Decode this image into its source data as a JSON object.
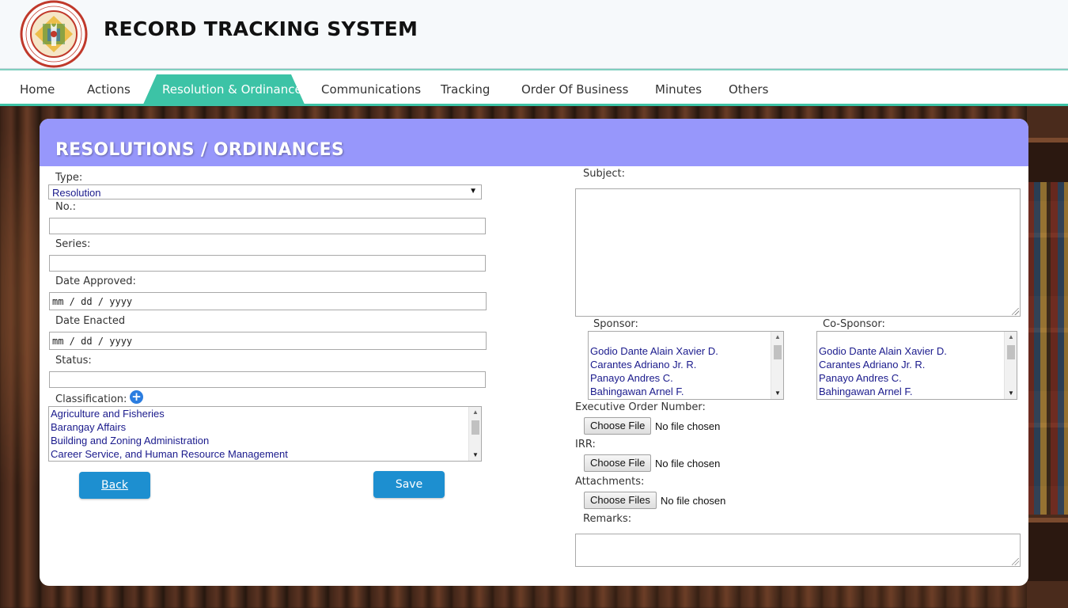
{
  "header": {
    "title": "RECORD TRACKING SYSTEM",
    "logo": {
      "top_text": "MUNICIPALITY OF ITOGON",
      "bottom_text": "PROVINCE OF BENGUET",
      "year": "1923"
    }
  },
  "nav": {
    "items": [
      {
        "label": "Home"
      },
      {
        "label": "Actions"
      },
      {
        "label": "Resolution & Ordinance",
        "active": true
      },
      {
        "label": "Communications"
      },
      {
        "label": "Tracking"
      },
      {
        "label": "Order Of Business"
      },
      {
        "label": "Minutes"
      },
      {
        "label": "Others"
      }
    ],
    "accent_color": "#3cc3a6"
  },
  "card": {
    "title": "RESOLUTIONS / ORDINANCES",
    "header_color": "#9797fb"
  },
  "form": {
    "type_label": "Type:",
    "type_value": "Resolution",
    "no_label": "No.:",
    "no_value": "",
    "series_label": "Series:",
    "series_value": "",
    "date_approved_label": "Date Approved:",
    "date_approved_placeholder": "mm / dd / yyyy",
    "date_enacted_label": "Date Enacted",
    "date_enacted_placeholder": "mm / dd / yyyy",
    "status_label": "Status:",
    "status_value": "",
    "classification_label": "Classification:",
    "classification_options": [
      "Agriculture and Fisheries",
      "Barangay Affairs",
      "Building and Zoning Administration",
      "Career Service, and Human Resource Management"
    ],
    "subject_label": "Subject:",
    "subject_value": "",
    "sponsor_label": "Sponsor:",
    "cosponsor_label": "Co-Sponsor:",
    "sponsor_options": [
      "Godio Dante Alain Xavier D.",
      "Carantes Adriano Jr. R.",
      "Panayo Andres C.",
      "Bahingawan Arnel F."
    ],
    "cosponsor_options": [
      "Godio Dante Alain Xavier D.",
      "Carantes Adriano Jr. R.",
      "Panayo Andres C.",
      "Bahingawan Arnel F."
    ],
    "eo_label": "Executive Order Number:",
    "irr_label": "IRR:",
    "attachments_label": "Attachments:",
    "remarks_label": "Remarks:",
    "choose_file": "Choose File",
    "choose_files": "Choose Files",
    "no_file": "No file chosen"
  },
  "buttons": {
    "back": "Back",
    "save": "Save",
    "color": "#1d8fd0"
  },
  "icons": {
    "add_classification": "plus-circle-icon",
    "select_arrow": "triangle-down-icon"
  }
}
